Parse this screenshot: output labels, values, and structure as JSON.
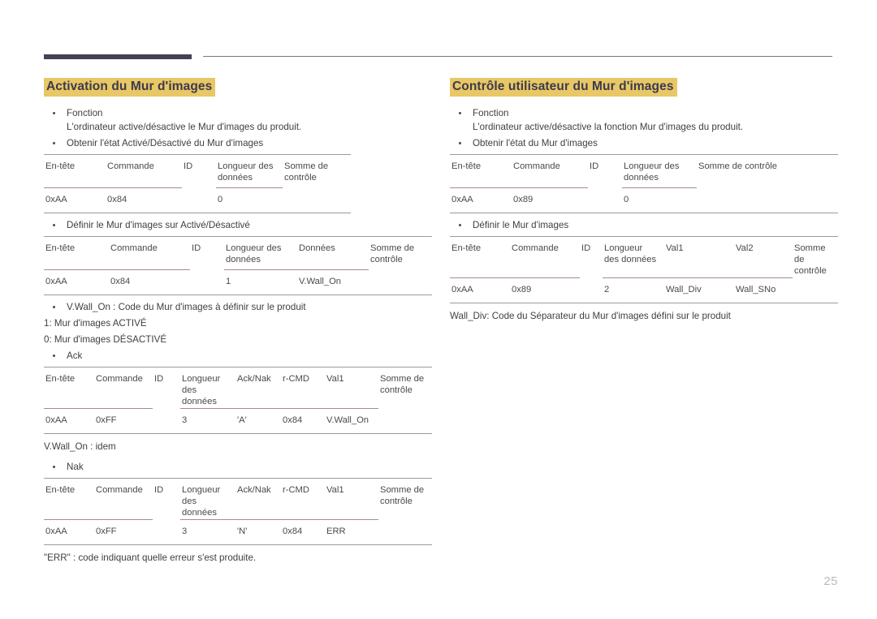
{
  "page": {
    "number": "25",
    "accent_color": "#e8c766",
    "rule_color": "#454157",
    "divider_color": "#a98a8a"
  },
  "left": {
    "title": "Activation du Mur d'images",
    "bullets": {
      "fonction_label": "Fonction",
      "fonction_text": "L'ordinateur active/désactive le Mur d'images du produit.",
      "get_state": "Obtenir l'état Activé/Désactivé du Mur d'images",
      "set_state": "Définir le Mur d'images sur Activé/Désactivé",
      "vwall_on": "V.Wall_On : Code du Mur d'images à définir sur le produit",
      "ack": "Ack",
      "nak": "Nak"
    },
    "lines": {
      "on": "1: Mur d'images ACTIVÉ",
      "off": "0: Mur d'images DÉSACTIVÉ",
      "idem": "V.Wall_On : idem",
      "err": "\"ERR\" : code indiquant quelle erreur s'est produite."
    },
    "table_get": {
      "headers": [
        "En-tête",
        "Commande",
        "ID",
        "Longueur des données",
        "Somme de contrôle"
      ],
      "row": [
        "0xAA",
        "0x84",
        "",
        "0",
        ""
      ]
    },
    "table_set": {
      "headers": [
        "En-tête",
        "Commande",
        "ID",
        "Longueur des données",
        "Données",
        "Somme de contrôle"
      ],
      "row": [
        "0xAA",
        "0x84",
        "",
        "1",
        "V.Wall_On",
        ""
      ]
    },
    "table_ack": {
      "headers": [
        "En-tête",
        "Commande",
        "ID",
        "Longueur des données",
        "Ack/Nak",
        "r-CMD",
        "Val1",
        "Somme de contrôle"
      ],
      "row": [
        "0xAA",
        "0xFF",
        "",
        "3",
        "'A'",
        "0x84",
        "V.Wall_On",
        ""
      ]
    },
    "table_nak": {
      "headers": [
        "En-tête",
        "Commande",
        "ID",
        "Longueur des données",
        "Ack/Nak",
        "r-CMD",
        "Val1",
        "Somme de contrôle"
      ],
      "row": [
        "0xAA",
        "0xFF",
        "",
        "3",
        "'N'",
        "0x84",
        "ERR",
        ""
      ]
    }
  },
  "right": {
    "title": "Contrôle utilisateur du Mur d'images",
    "bullets": {
      "fonction_label": "Fonction",
      "fonction_text": "L'ordinateur active/désactive la fonction Mur d'images du produit.",
      "get_state": "Obtenir l'état du Mur d'images",
      "set_state": "Définir le Mur d'images"
    },
    "lines": {
      "wall_div": "Wall_Div: Code du Séparateur du Mur d'images défini sur le produit"
    },
    "table_get": {
      "headers": [
        "En-tête",
        "Commande",
        "ID",
        "Longueur des données",
        "Somme de contrôle"
      ],
      "row": [
        "0xAA",
        "0x89",
        "",
        "0",
        ""
      ]
    },
    "table_set": {
      "headers": [
        "En-tête",
        "Commande",
        "ID",
        "Longueur des données",
        "Val1",
        "Val2",
        "Somme de contrôle"
      ],
      "row": [
        "0xAA",
        "0x89",
        "",
        "2",
        "Wall_Div",
        "Wall_SNo",
        ""
      ]
    }
  }
}
